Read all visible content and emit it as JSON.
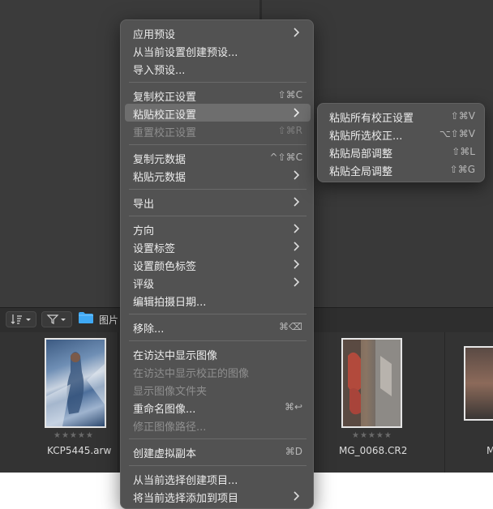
{
  "toolbar": {
    "sort_icon": "sort-icon",
    "filter_icon": "filter-icon",
    "folder_label": "图片"
  },
  "filmstrip": {
    "items": [
      {
        "filename": "KCP5445.arw",
        "stars": "★★★★★"
      },
      {
        "filename": "MG_0068.CR2",
        "stars": "★★★★★"
      },
      {
        "filename": "M",
        "stars": ""
      }
    ]
  },
  "context_menu": {
    "items": [
      {
        "label": "应用预设",
        "shortcut": "",
        "submenu": true,
        "enabled": true
      },
      {
        "label": "从当前设置创建预设...",
        "shortcut": "",
        "submenu": false,
        "enabled": true
      },
      {
        "label": "导入预设...",
        "shortcut": "",
        "submenu": false,
        "enabled": true
      },
      {
        "label": "复制校正设置",
        "shortcut": "⇧⌘C",
        "submenu": false,
        "enabled": true
      },
      {
        "label": "粘贴校正设置",
        "shortcut": "",
        "submenu": true,
        "enabled": true,
        "highlighted": true
      },
      {
        "label": "重置校正设置",
        "shortcut": "⇧⌘R",
        "submenu": false,
        "enabled": false
      },
      {
        "label": "复制元数据",
        "shortcut": "^⇧⌘C",
        "submenu": false,
        "enabled": true
      },
      {
        "label": "粘贴元数据",
        "shortcut": "",
        "submenu": true,
        "enabled": true
      },
      {
        "label": "导出",
        "shortcut": "",
        "submenu": true,
        "enabled": true
      },
      {
        "label": "方向",
        "shortcut": "",
        "submenu": true,
        "enabled": true
      },
      {
        "label": "设置标签",
        "shortcut": "",
        "submenu": true,
        "enabled": true
      },
      {
        "label": "设置颜色标签",
        "shortcut": "",
        "submenu": true,
        "enabled": true
      },
      {
        "label": "评级",
        "shortcut": "",
        "submenu": true,
        "enabled": true
      },
      {
        "label": "编辑拍摄日期...",
        "shortcut": "",
        "submenu": false,
        "enabled": true
      },
      {
        "label": "移除...",
        "shortcut": "⌘⌫",
        "submenu": false,
        "enabled": true
      },
      {
        "label": "在访达中显示图像",
        "shortcut": "",
        "submenu": false,
        "enabled": true
      },
      {
        "label": "在访达中显示校正的图像",
        "shortcut": "",
        "submenu": false,
        "enabled": false
      },
      {
        "label": "显示图像文件夹",
        "shortcut": "",
        "submenu": false,
        "enabled": false
      },
      {
        "label": "重命名图像...",
        "shortcut": "⌘↩",
        "submenu": false,
        "enabled": true
      },
      {
        "label": "修正图像路径...",
        "shortcut": "",
        "submenu": false,
        "enabled": false
      },
      {
        "label": "创建虚拟副本",
        "shortcut": "⌘D",
        "submenu": false,
        "enabled": true
      },
      {
        "label": "从当前选择创建项目...",
        "shortcut": "",
        "submenu": false,
        "enabled": true
      },
      {
        "label": "将当前选择添加到项目",
        "shortcut": "",
        "submenu": true,
        "enabled": true
      }
    ]
  },
  "paste_submenu": {
    "items": [
      {
        "label": "粘贴所有校正设置",
        "shortcut": "⇧⌘V"
      },
      {
        "label": "粘贴所选校正...",
        "shortcut": "⌥⇧⌘V"
      },
      {
        "label": "粘贴局部调整",
        "shortcut": "⇧⌘L"
      },
      {
        "label": "粘贴全局调整",
        "shortcut": "⇧⌘G"
      }
    ]
  },
  "colors": {
    "menu_bg": "#525252",
    "highlight": "#6e6e6e",
    "folder_blue": "#3fa9f5"
  }
}
